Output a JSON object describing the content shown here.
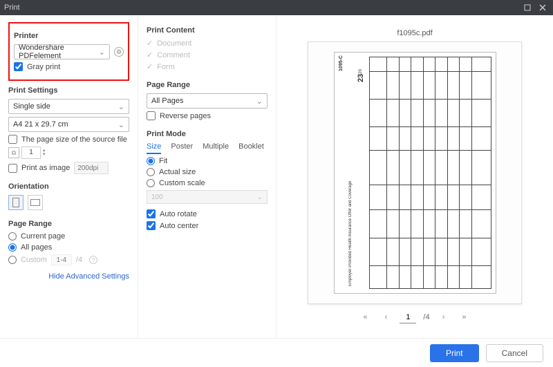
{
  "window": {
    "title": "Print"
  },
  "printer": {
    "heading": "Printer",
    "selected": "Wondershare PDFelement",
    "gray_print_label": "Gray print",
    "gray_print_checked": true
  },
  "print_settings": {
    "heading": "Print Settings",
    "sides": "Single side",
    "paper": "A4 21 x 29.7 cm",
    "source_size_label": "The page size of the source file",
    "copies_value": "1",
    "print_as_image_label": "Print as image",
    "dpi_placeholder": "200dpi"
  },
  "orientation": {
    "heading": "Orientation"
  },
  "page_range_left": {
    "heading": "Page Range",
    "current": "Current page",
    "all": "All pages",
    "custom": "Custom",
    "custom_from": "1-4",
    "custom_total": "/4"
  },
  "advanced_link": "Hide Advanced Settings",
  "print_content": {
    "heading": "Print Content",
    "document": "Document",
    "comment": "Comment",
    "form": "Form"
  },
  "page_range_right": {
    "heading": "Page Range",
    "selected": "All Pages",
    "reverse": "Reverse pages"
  },
  "print_mode": {
    "heading": "Print Mode",
    "tabs": {
      "size": "Size",
      "poster": "Poster",
      "multiple": "Multiple",
      "booklet": "Booklet"
    },
    "fit": "Fit",
    "actual": "Actual size",
    "custom_scale": "Custom scale",
    "scale_value": "100",
    "auto_rotate": "Auto rotate",
    "auto_center": "Auto center"
  },
  "preview": {
    "filename": "f1095c.pdf",
    "form_code": "1095-C",
    "form_title": "Employer-Provided Health Insurance Offer and Coverage",
    "year_big": "23",
    "year_small": "20",
    "page_current": "1",
    "page_total": "/4"
  },
  "footer": {
    "print": "Print",
    "cancel": "Cancel"
  }
}
